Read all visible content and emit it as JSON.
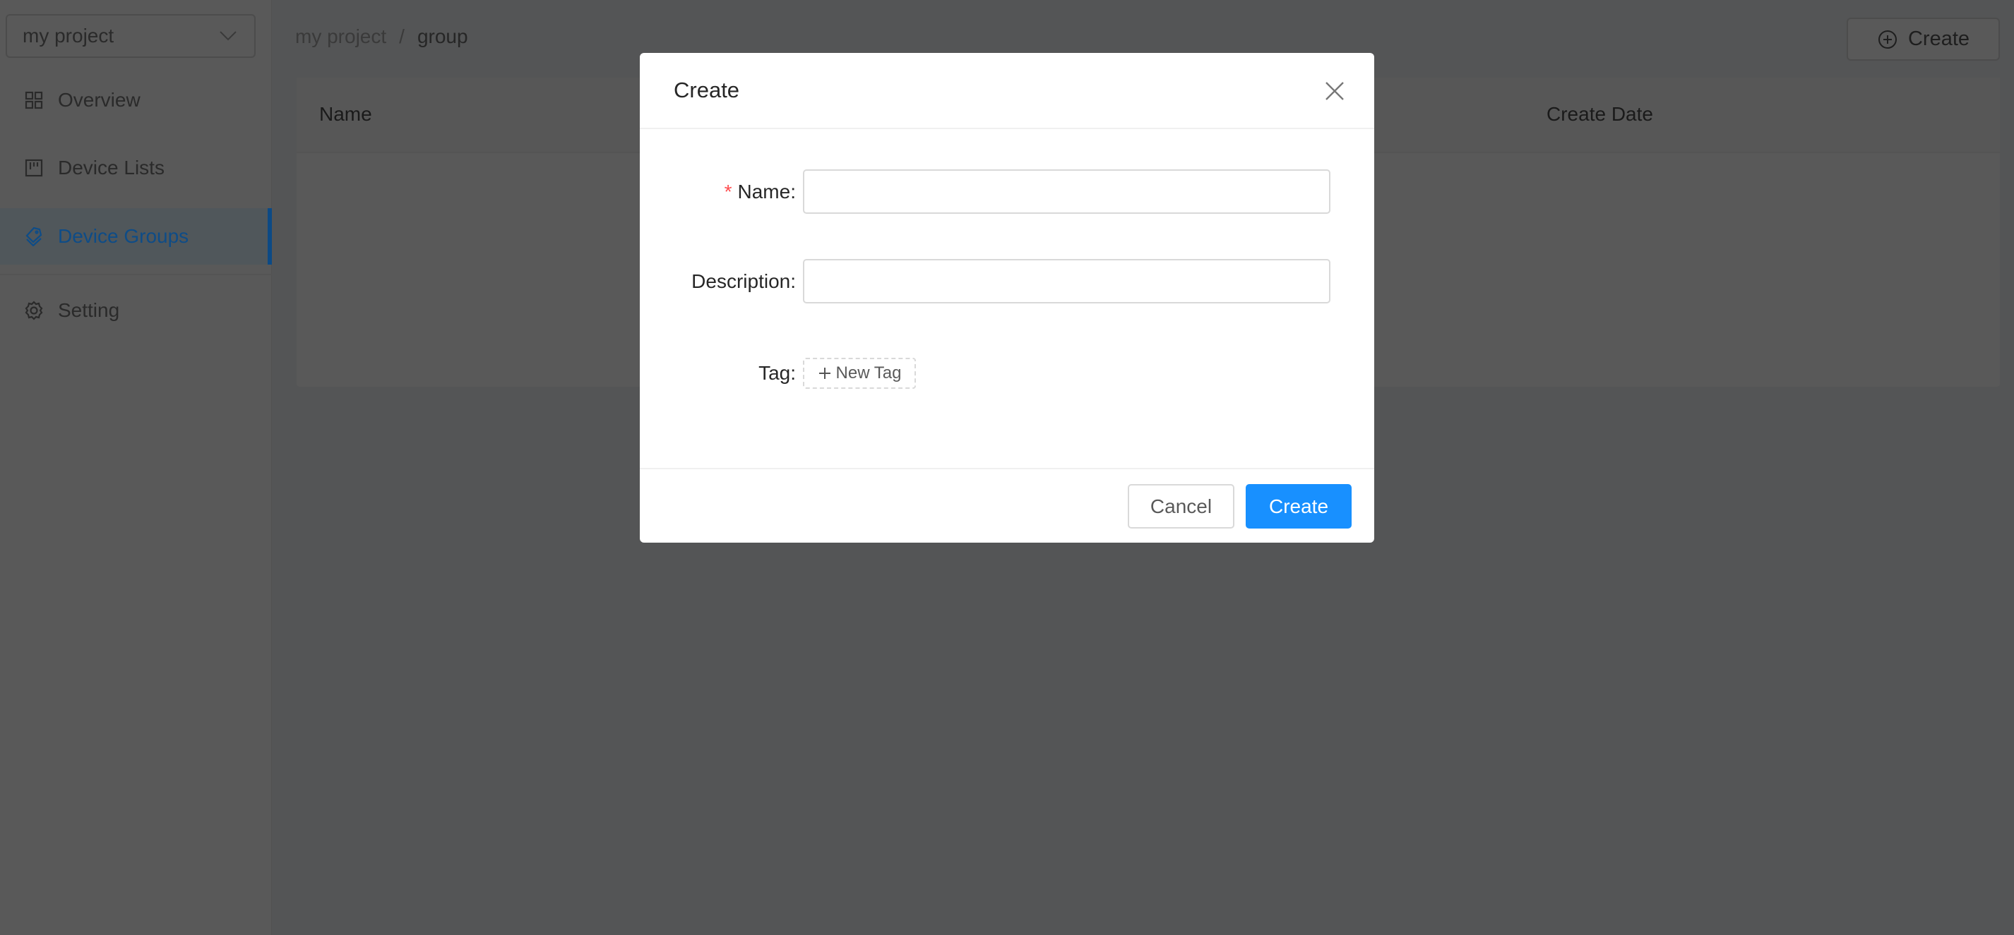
{
  "sidebar": {
    "project_select": "my project",
    "items": [
      {
        "label": "Overview",
        "icon": "grid-icon"
      },
      {
        "label": "Device Lists",
        "icon": "board-icon"
      },
      {
        "label": "Device Groups",
        "icon": "tags-icon",
        "active": true
      },
      {
        "label": "Setting",
        "icon": "gear-icon"
      }
    ]
  },
  "breadcrumb": {
    "items": [
      "my project",
      "group"
    ],
    "separator": "/"
  },
  "toolbar": {
    "create_label": "Create"
  },
  "table": {
    "columns": [
      "Name",
      "Create Date"
    ]
  },
  "modal": {
    "title": "Create",
    "fields": {
      "name_label": "Name",
      "name_value": "",
      "description_label": "Description",
      "description_value": "",
      "tag_label": "Tag",
      "new_tag_label": "New Tag"
    },
    "cancel_label": "Cancel",
    "ok_label": "Create"
  },
  "colors": {
    "accent": "#1890ff",
    "required": "#ff4d4f"
  }
}
